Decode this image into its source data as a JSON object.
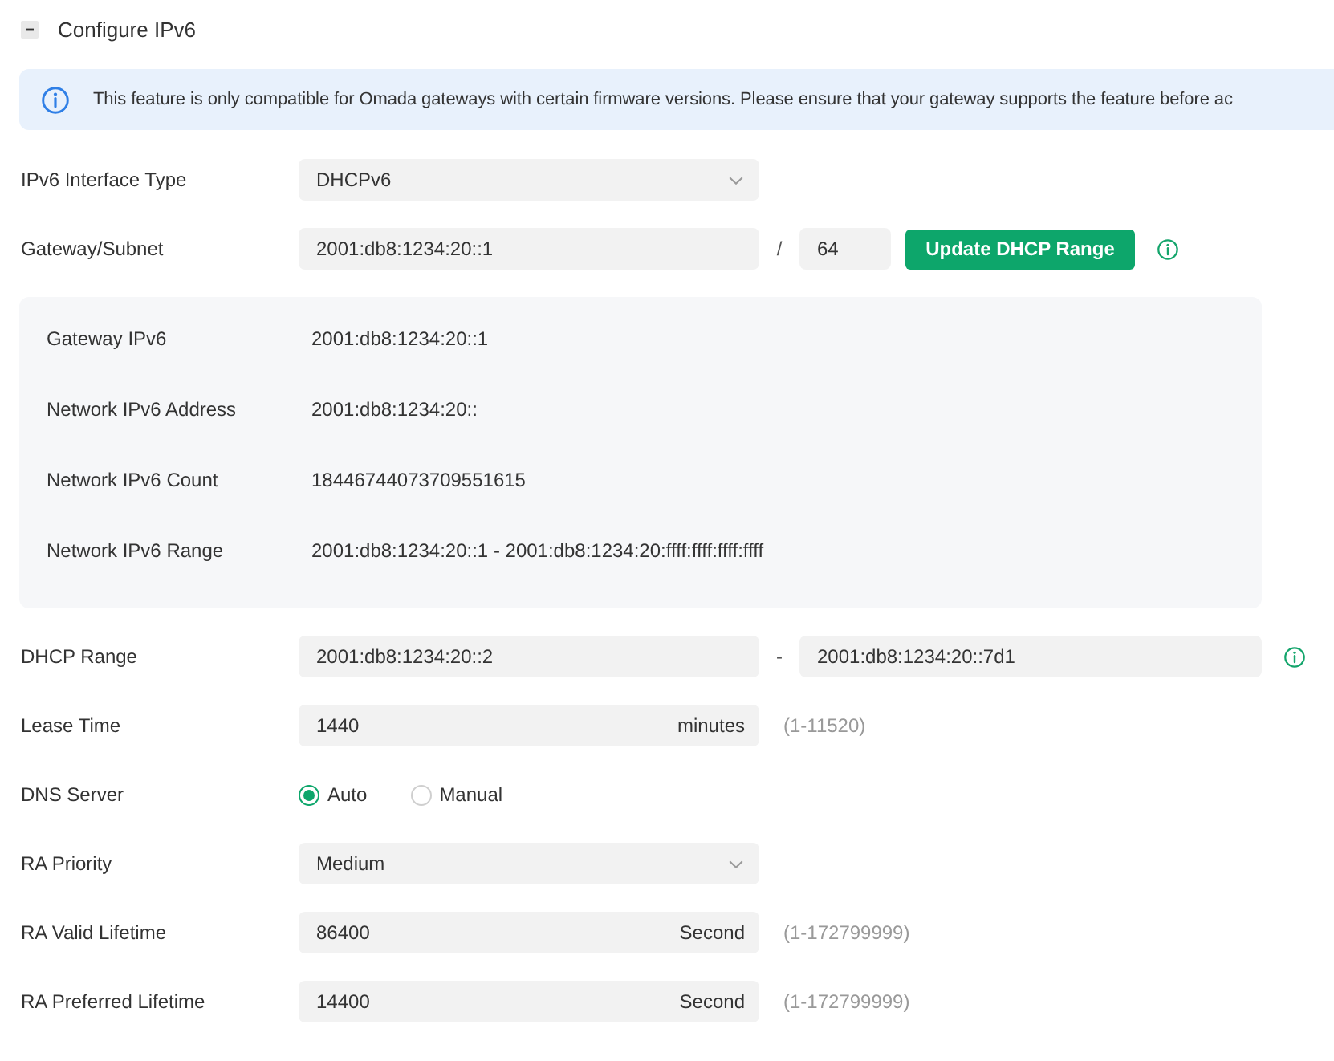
{
  "section": {
    "title": "Configure IPv6",
    "expanded": true
  },
  "notice": {
    "text": "This feature is only compatible for Omada gateways with certain firmware versions. Please ensure that your gateway supports the feature before ac"
  },
  "form": {
    "rows": [
      {
        "kind": "select",
        "label": "IPv6 Interface Type",
        "value": "DHCPv6"
      },
      {
        "kind": "subnet",
        "label": "Gateway/Subnet",
        "value": "2001:db8:1234:20::1",
        "separator": "/",
        "prefix": "64",
        "button": "Update DHCP Range"
      },
      {
        "kind": "summary",
        "items": [
          {
            "label": "Gateway IPv6",
            "value": "2001:db8:1234:20::1"
          },
          {
            "label": "Network IPv6 Address",
            "value": "2001:db8:1234:20::"
          },
          {
            "label": "Network IPv6 Count",
            "value": "18446744073709551615"
          },
          {
            "label": "Network IPv6 Range",
            "value": "2001:db8:1234:20::1 - 2001:db8:1234:20:ffff:ffff:ffff:ffff"
          }
        ]
      },
      {
        "kind": "range",
        "label": "DHCP Range",
        "start": "2001:db8:1234:20::2",
        "separator": "-",
        "end": "2001:db8:1234:20::7d1"
      },
      {
        "kind": "unit",
        "label": "Lease Time",
        "value": "1440",
        "unit": "minutes",
        "hint": "(1-11520)"
      },
      {
        "kind": "radio",
        "label": "DNS Server",
        "options": [
          {
            "label": "Auto",
            "selected": true
          },
          {
            "label": "Manual",
            "selected": false
          }
        ]
      },
      {
        "kind": "select",
        "label": "RA Priority",
        "value": "Medium"
      },
      {
        "kind": "unit",
        "label": "RA Valid Lifetime",
        "value": "86400",
        "unit": "Second",
        "hint": "(1-172799999)"
      },
      {
        "kind": "unit",
        "label": "RA Preferred Lifetime",
        "value": "14400",
        "unit": "Second",
        "hint": "(1-172799999)"
      }
    ]
  }
}
